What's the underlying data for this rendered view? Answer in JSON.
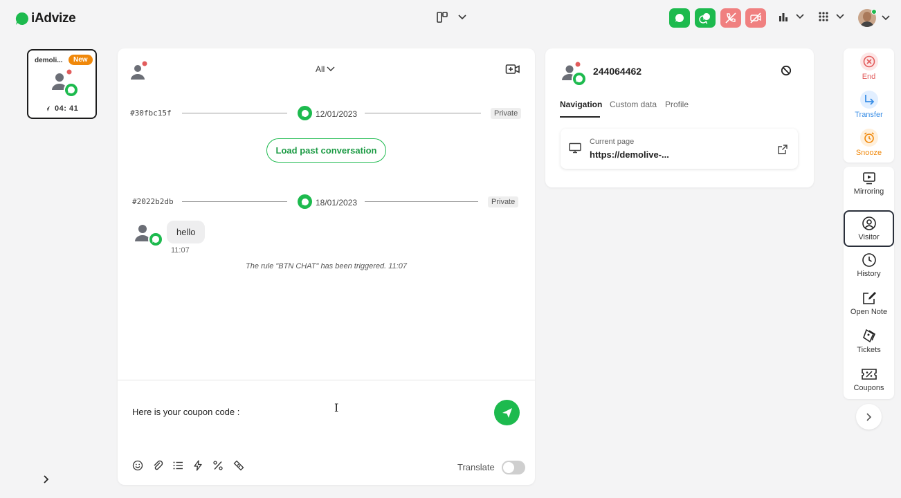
{
  "brand": {
    "name": "iAdvize",
    "accent": "#1dba4e"
  },
  "topbar": {
    "layout_icon": "layout-columns-icon",
    "channels": [
      {
        "name": "chat",
        "color": "#1dba4e"
      },
      {
        "name": "chat-multi",
        "color": "#1dba4e"
      },
      {
        "name": "call-off",
        "color": "#f08080"
      },
      {
        "name": "video-off",
        "color": "#f08080"
      }
    ],
    "stats_icon": "bar-chart-icon",
    "apps_icon": "grid-icon"
  },
  "conversation_card": {
    "name": "demoli...",
    "badge": "New",
    "timer": "04: 41"
  },
  "chat": {
    "filter": "All",
    "threads": [
      {
        "id": "#30fbc15f",
        "date": "12/01/2023",
        "visibility": "Private"
      },
      {
        "id": "#2022b2db",
        "date": "18/01/2023",
        "visibility": "Private"
      }
    ],
    "load_past": "Load past conversation",
    "message": {
      "text": "hello",
      "time": "11:07"
    },
    "rule_note": "The rule \"BTN CHAT\" has been triggered.   11:07",
    "composer_text": "Here is your coupon code :",
    "translate_label": "Translate"
  },
  "visitor": {
    "id": "244064462",
    "tabs": [
      "Navigation",
      "Custom data",
      "Profile"
    ],
    "active_tab": "Navigation",
    "current_page_label": "Current page",
    "current_page_url": "https://demolive-..."
  },
  "actions": [
    {
      "label": "End",
      "color": "#e25c5c"
    },
    {
      "label": "Transfer",
      "color": "#3a8ee6"
    },
    {
      "label": "Snooze",
      "color": "#f0880a"
    },
    {
      "label": "Mirroring"
    },
    {
      "label": "Visitor"
    },
    {
      "label": "History"
    },
    {
      "label": "Open Note"
    },
    {
      "label": "Tickets"
    },
    {
      "label": "Coupons"
    }
  ]
}
